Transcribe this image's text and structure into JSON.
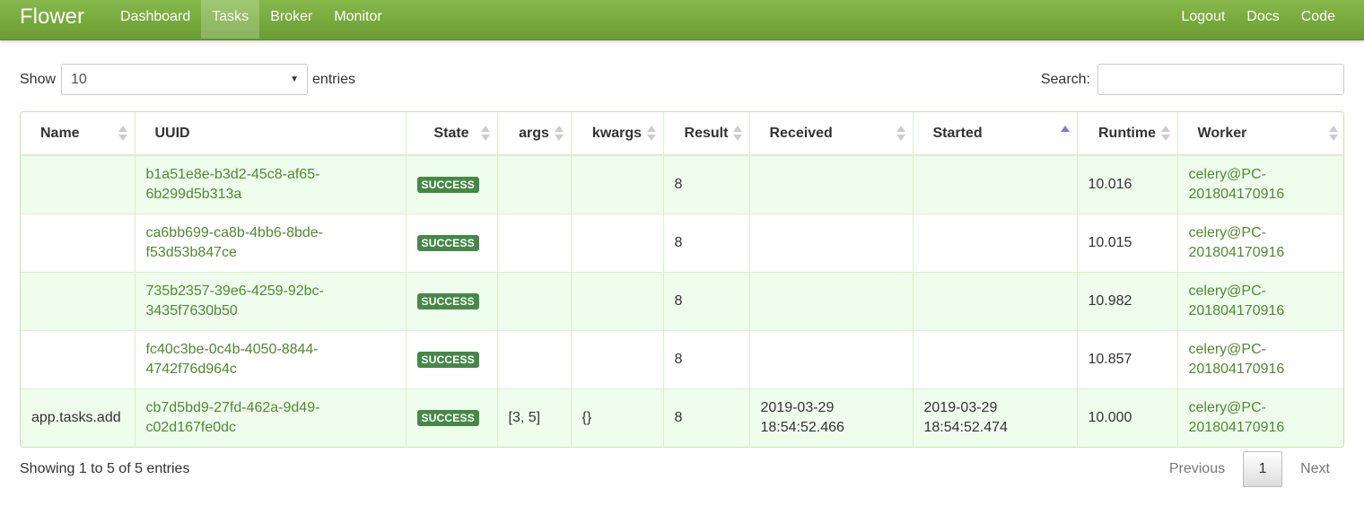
{
  "navbar": {
    "brand": "Flower",
    "left_items": [
      {
        "label": "Dashboard",
        "active": false
      },
      {
        "label": "Tasks",
        "active": true
      },
      {
        "label": "Broker",
        "active": false
      },
      {
        "label": "Monitor",
        "active": false
      }
    ],
    "right_items": [
      {
        "label": "Logout"
      },
      {
        "label": "Docs"
      },
      {
        "label": "Code"
      }
    ]
  },
  "length_control": {
    "prefix": "Show",
    "value": "10",
    "suffix": "entries"
  },
  "search": {
    "label": "Search:",
    "value": ""
  },
  "table": {
    "columns": [
      {
        "label": "Name",
        "sort": "none"
      },
      {
        "label": "UUID",
        "sort": "none"
      },
      {
        "label": "State",
        "sort": "none"
      },
      {
        "label": "args",
        "sort": "none"
      },
      {
        "label": "kwargs",
        "sort": "none"
      },
      {
        "label": "Result",
        "sort": "none"
      },
      {
        "label": "Received",
        "sort": "none"
      },
      {
        "label": "Started",
        "sort": "asc"
      },
      {
        "label": "Runtime",
        "sort": "none"
      },
      {
        "label": "Worker",
        "sort": "none"
      }
    ],
    "rows": [
      {
        "name": "",
        "uuid": "b1a51e8e-b3d2-45c8-af65-6b299d5b313a",
        "state": "SUCCESS",
        "args": "",
        "kwargs": "",
        "result": "8",
        "received": "",
        "started": "",
        "runtime": "10.016",
        "worker": "celery@PC-201804170916"
      },
      {
        "name": "",
        "uuid": "ca6bb699-ca8b-4bb6-8bde-f53d53b847ce",
        "state": "SUCCESS",
        "args": "",
        "kwargs": "",
        "result": "8",
        "received": "",
        "started": "",
        "runtime": "10.015",
        "worker": "celery@PC-201804170916"
      },
      {
        "name": "",
        "uuid": "735b2357-39e6-4259-92bc-3435f7630b50",
        "state": "SUCCESS",
        "args": "",
        "kwargs": "",
        "result": "8",
        "received": "",
        "started": "",
        "runtime": "10.982",
        "worker": "celery@PC-201804170916"
      },
      {
        "name": "",
        "uuid": "fc40c3be-0c4b-4050-8844-4742f76d964c",
        "state": "SUCCESS",
        "args": "",
        "kwargs": "",
        "result": "8",
        "received": "",
        "started": "",
        "runtime": "10.857",
        "worker": "celery@PC-201804170916"
      },
      {
        "name": "app.tasks.add",
        "uuid": "cb7d5bd9-27fd-462a-9d49-c02d167fe0dc",
        "state": "SUCCESS",
        "args": "[3, 5]",
        "kwargs": "{}",
        "result": "8",
        "received": "2019-03-29 18:54:52.466",
        "started": "2019-03-29 18:54:52.474",
        "runtime": "10.000",
        "worker": "celery@PC-201804170916"
      }
    ]
  },
  "footer": {
    "info": "Showing 1 to 5 of 5 entries",
    "previous": "Previous",
    "current_page": "1",
    "next": "Next"
  },
  "colors": {
    "navbar": "#7aae3f",
    "link": "#4f8a2f",
    "success_badge": "#468847",
    "odd_row": "#effded",
    "table_border": "#c6e6b3"
  }
}
